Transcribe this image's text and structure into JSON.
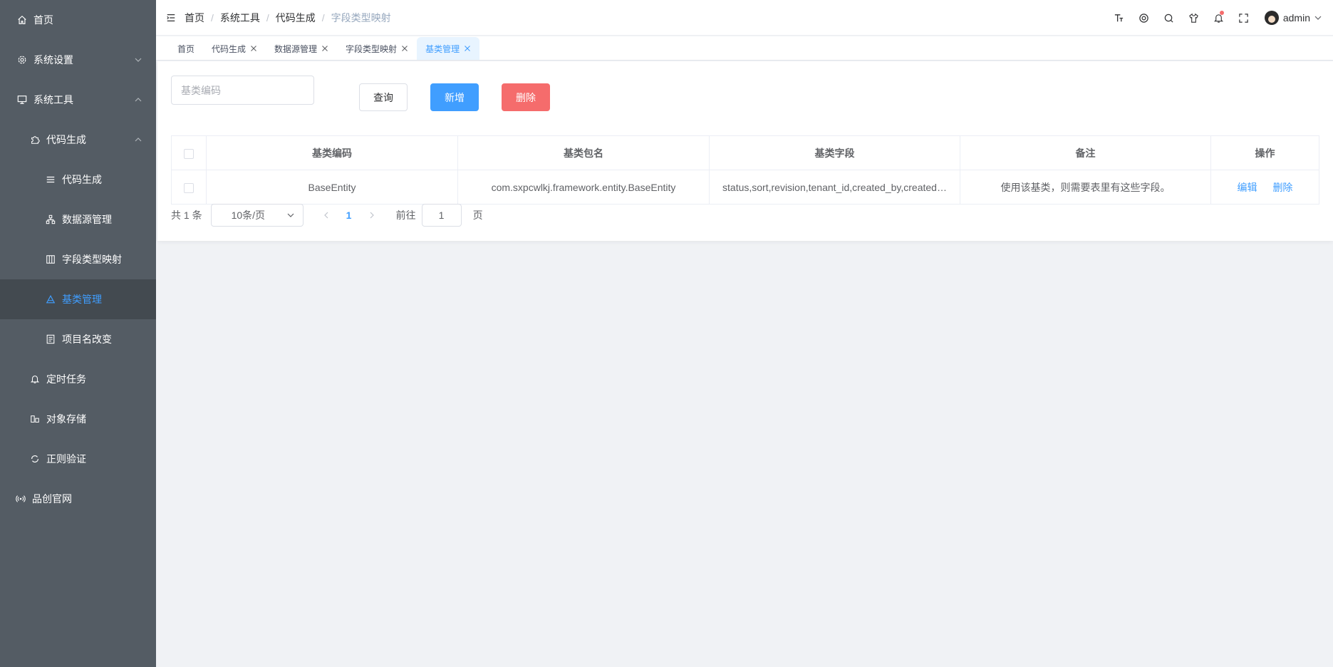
{
  "sidebar": {
    "items": [
      {
        "label": "首页",
        "icon": "home-icon"
      },
      {
        "label": "系统设置",
        "icon": "gear-icon",
        "expanded": false
      },
      {
        "label": "系统工具",
        "icon": "monitor-icon",
        "expanded": true
      },
      {
        "label": "代码生成",
        "icon": "puzzle-icon",
        "expanded": true
      },
      {
        "label": "代码生成",
        "icon": "list-icon"
      },
      {
        "label": "数据源管理",
        "icon": "tree-icon"
      },
      {
        "label": "字段类型映射",
        "icon": "grid-icon"
      },
      {
        "label": "基类管理",
        "icon": "triangle-icon",
        "active": true
      },
      {
        "label": "项目名改变",
        "icon": "document-icon"
      },
      {
        "label": "定时任务",
        "icon": "bell-icon"
      },
      {
        "label": "对象存储",
        "icon": "storage-icon"
      },
      {
        "label": "正则验证",
        "icon": "refresh-icon"
      },
      {
        "label": "品创官网",
        "icon": "broadcast-icon"
      }
    ]
  },
  "header": {
    "breadcrumb": [
      "首页",
      "系统工具",
      "代码生成",
      "字段类型映射"
    ],
    "user": "admin",
    "notification_dot_color": "#f56c6c"
  },
  "tags": [
    {
      "label": "首页",
      "closable": false
    },
    {
      "label": "代码生成",
      "closable": true
    },
    {
      "label": "数据源管理",
      "closable": true
    },
    {
      "label": "字段类型映射",
      "closable": true
    },
    {
      "label": "基类管理",
      "closable": true,
      "active": true
    }
  ],
  "search": {
    "placeholder": "基类编码",
    "value": ""
  },
  "buttons": {
    "query": "查询",
    "add": "新增",
    "delete": "删除"
  },
  "table": {
    "columns": [
      "基类编码",
      "基类包名",
      "基类字段",
      "备注",
      "操作"
    ],
    "rows": [
      {
        "code": "BaseEntity",
        "package": "com.sxpcwlkj.framework.entity.BaseEntity",
        "fields": "status,sort,revision,tenant_id,created_by,created…",
        "remark": "使用该基类，则需要表里有这些字段。",
        "actions": [
          "编辑",
          "删除"
        ]
      }
    ]
  },
  "pagination": {
    "total_text": "共 1 条",
    "page_size": "10条/页",
    "current_page": "1",
    "goto_label": "前往",
    "goto_value": "1",
    "page_unit": "页"
  },
  "colors": {
    "sidebar_bg": "#545c64",
    "accent": "#409eff",
    "danger": "#f56c6c"
  }
}
